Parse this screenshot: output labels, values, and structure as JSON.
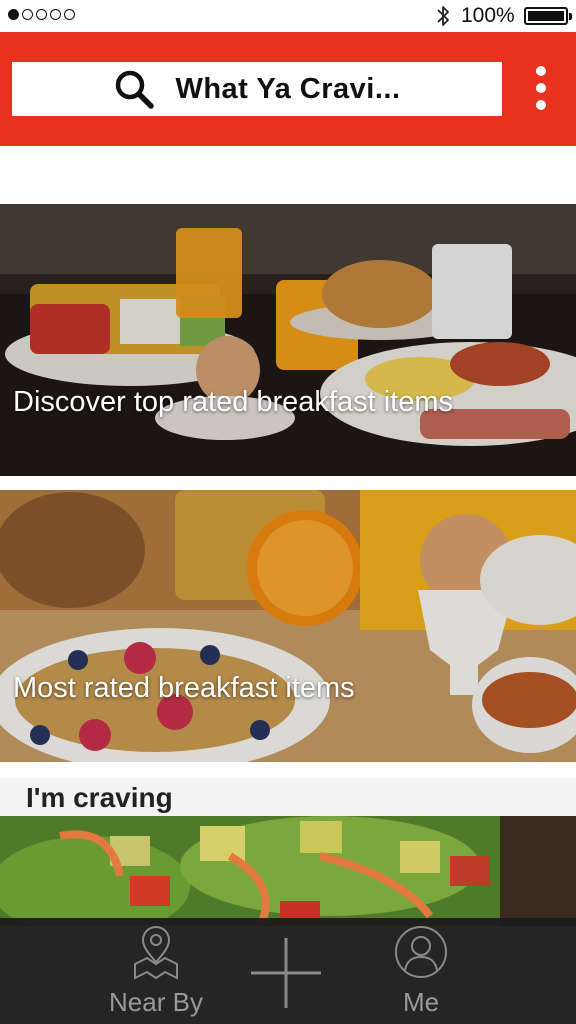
{
  "status_bar": {
    "signal_dots_filled": 1,
    "signal_dots_total": 5,
    "bluetooth_icon": "bluetooth-icon",
    "battery_text": "100%",
    "battery_level": 1.0
  },
  "header": {
    "background_color": "#e8321e",
    "search": {
      "icon": "search-icon",
      "text": "What Ya Cravi..."
    },
    "menu_icon": "more-vertical-icon"
  },
  "cards": [
    {
      "label": "Discover top rated breakfast items",
      "image": "breakfast-table-photo"
    },
    {
      "label": "Most rated breakfast items",
      "image": "cereal-and-egg-photo"
    }
  ],
  "section": {
    "title": "I'm craving",
    "image": "salad-photo"
  },
  "bottom_nav": {
    "items": [
      {
        "label": "Near By",
        "icon": "map-pin-icon"
      },
      {
        "label": "",
        "icon": "plus-icon"
      },
      {
        "label": "Me",
        "icon": "user-icon"
      }
    ]
  }
}
